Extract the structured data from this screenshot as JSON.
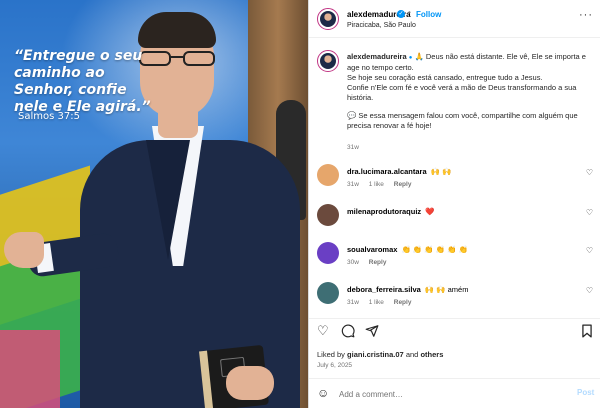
{
  "photo": {
    "quote": "Entregue o seu caminho ao Senhor, confie nele e Ele agirá.",
    "quote_open": "“",
    "quote_close": "”",
    "verse": "Salmos 37:5"
  },
  "header": {
    "username": "alexdemadureira",
    "verified_icon": "verified-badge-icon",
    "separator": "•",
    "follow_label": "Follow",
    "location": "Piracicaba, São Paulo",
    "more_label": "···"
  },
  "caption": {
    "username": "alexdemadureira",
    "emoji": "🙏",
    "line1": "Deus não está distante. Ele vê, Ele se importa e age no tempo certo.",
    "line2": "Se hoje seu coração está cansado, entregue tudo a Jesus.",
    "line3": "Confie n'Ele com fé e você verá a mão de Deus transformando a sua história.",
    "line4": "💬 Se essa mensagem falou com você, compartilhe com alguém que precisa renovar a fé hoje!",
    "time": "31w"
  },
  "comments": [
    {
      "user": "dra.lucimara.alcantara",
      "text": "🙌 🙌",
      "time": "31w",
      "likes": "1 like",
      "reply": "Reply",
      "avatar_color": "#e6a66b"
    },
    {
      "user": "milenaprodutoraquiz",
      "text": "❤️",
      "time": "31w",
      "likes": "1 like",
      "reply": "Reply",
      "avatar_color": "#6b4a3d"
    },
    {
      "user": "soualvaromax",
      "text": "👏 👏 👏 👏 👏 👏",
      "time": "30w",
      "likes": "",
      "reply": "Reply",
      "avatar_color": "#6a3fc4"
    },
    {
      "user": "debora_ferreira.silva",
      "text": "🙌 🙌 amém",
      "time": "31w",
      "likes": "1 like",
      "reply": "Reply",
      "avatar_color": "#3e6e74"
    }
  ],
  "actions": {
    "like_icon": "heart-icon",
    "comment_icon": "comment-icon",
    "share_icon": "share-icon",
    "save_icon": "bookmark-icon"
  },
  "likes": {
    "prefix": "Liked by",
    "user": "giani.cristina.07",
    "conj": "and",
    "others": "others"
  },
  "date": "July 6, 2025",
  "comment_bar": {
    "placeholder": "Add a comment…",
    "post_label": "Post",
    "emoji_icon": "smiley-icon"
  },
  "colors": {
    "accent": "#0095f6",
    "muted": "#737373",
    "post_disabled": "#b3dbff"
  }
}
